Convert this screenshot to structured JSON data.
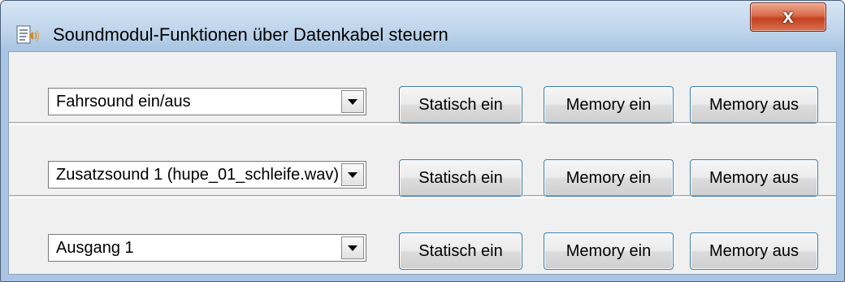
{
  "window": {
    "title": "Soundmodul-Funktionen über Datenkabel steuern",
    "icon": "sound-module-icon",
    "close_label": "x"
  },
  "rows": [
    {
      "select_value": "Fahrsound ein/aus",
      "btn_static": "Statisch ein",
      "btn_mem_on": "Memory ein",
      "btn_mem_off": "Memory aus"
    },
    {
      "select_value": "Zusatzsound 1 (hupe_01_schleife.wav)",
      "btn_static": "Statisch ein",
      "btn_mem_on": "Memory ein",
      "btn_mem_off": "Memory aus"
    },
    {
      "select_value": "Ausgang 1",
      "btn_static": "Statisch ein",
      "btn_mem_on": "Memory ein",
      "btn_mem_off": "Memory aus"
    }
  ],
  "colors": {
    "titlebar": "#bcd3ea",
    "client": "#f0f0f0",
    "close_button": "#c4411f",
    "button_border": "#3c7fb1"
  }
}
